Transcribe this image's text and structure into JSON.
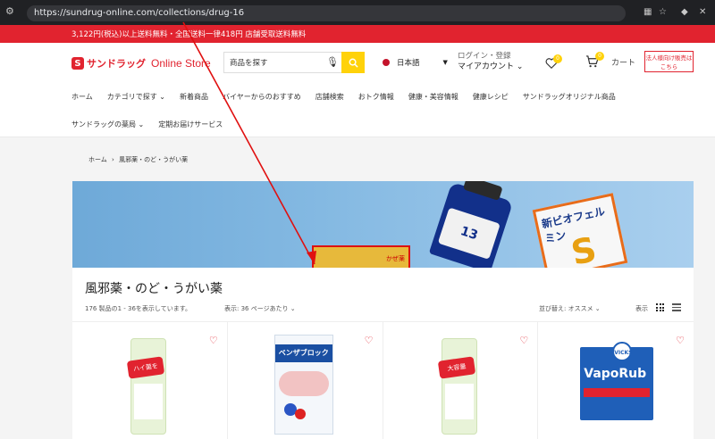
{
  "browser": {
    "url": "https://sundrug-online.com/collections/drug-16",
    "icons": [
      "tune-icon",
      "qr-icon",
      "star-icon",
      "extension-icon",
      "close-icon"
    ]
  },
  "promo": {
    "text": "3,122円(税込)以上送料無料・全国送料一律418円 店舗受取送料無料"
  },
  "header": {
    "logo_ja": "サンドラッグ",
    "logo_en": "Online Store",
    "search_placeholder": "商品を探す",
    "language": "日本語",
    "login": "ログイン・登録",
    "account": "マイアカウント",
    "wishlist_count": "0",
    "cart_count": "0",
    "cart_label": "カート",
    "corporate_line1": "法人様向け販売は",
    "corporate_line2": "こちら"
  },
  "nav": {
    "row1": [
      "ホーム",
      "カテゴリで探す ⌄",
      "新着商品",
      "バイヤーからのおすすめ",
      "店舗検索",
      "おトク情報",
      "健康・美容情報",
      "健康レシピ",
      "サンドラッグオリジナル商品"
    ],
    "row2": [
      "サンドラッグの薬局 ⌄",
      "定期お届けサービス"
    ]
  },
  "breadcrumb": {
    "home": "ホーム",
    "sep": "›",
    "current": "風邪薬・のど・うがい薬"
  },
  "collection": {
    "title": "風邪薬・のど・うがい薬",
    "count_text": "176 製品の1 - 36を表示しています。",
    "per_page": "表示: 36 ページあたり ⌄",
    "sort": "並び替え: オススメ ⌄",
    "view_label": "表示"
  },
  "banner": {
    "bottle_label": "13",
    "box_label": "かぜ薬",
    "bio_label": "新ビオフェルミン"
  },
  "products": [
    {
      "band": "ハイ菌を",
      "wishlist": "♡"
    },
    {
      "top": "ベンザブロック",
      "wishlist": "♡"
    },
    {
      "band": "大容量",
      "wishlist": "♡"
    },
    {
      "name": "VapoRub",
      "brand": "VICKS",
      "wishlist": "♡"
    }
  ],
  "colors": {
    "brand_red": "#e1232f",
    "accent_yellow": "#ffd20a",
    "annotation_red": "#e01010"
  }
}
